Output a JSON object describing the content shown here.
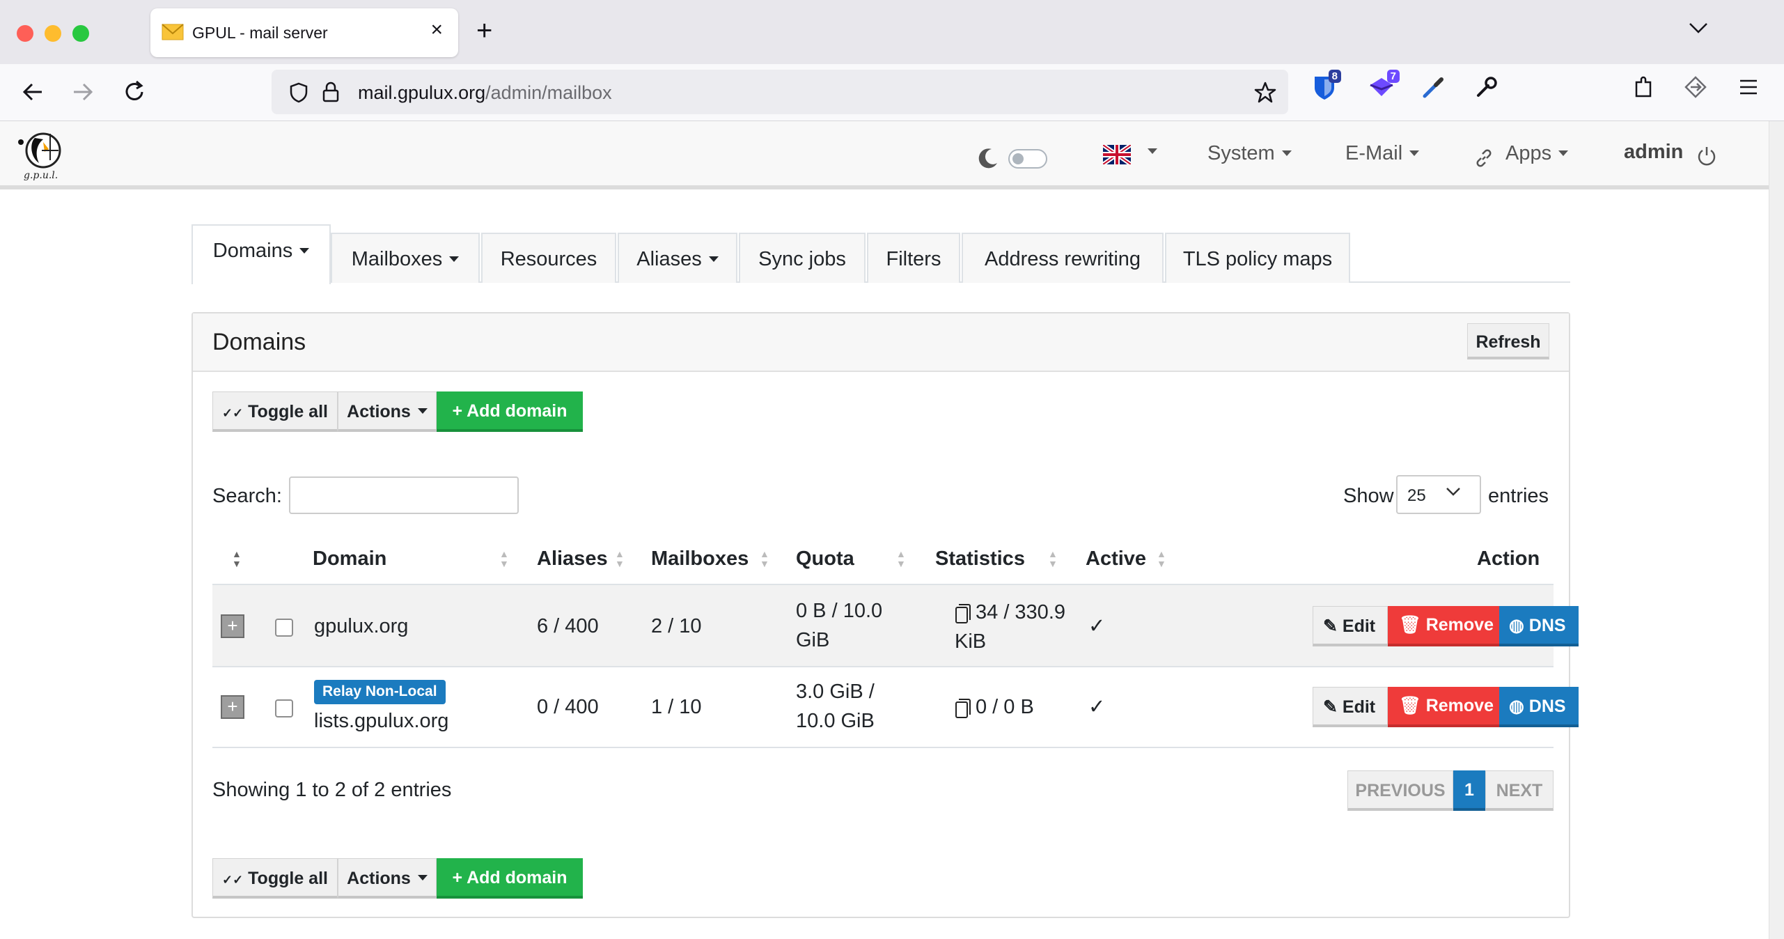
{
  "browser": {
    "tab_title": "GPUL - mail server",
    "url_host": "mail.gpulux.org",
    "url_path": "/admin/mailbox",
    "url_prefix": "",
    "ext_badges": [
      "8",
      "7"
    ]
  },
  "header": {
    "system": "System",
    "email": "E-Mail",
    "apps": "Apps",
    "user": "admin"
  },
  "tabs": [
    "Domains",
    "Mailboxes",
    "Resources",
    "Aliases",
    "Sync jobs",
    "Filters",
    "Address rewriting",
    "TLS policy maps"
  ],
  "panel": {
    "title": "Domains",
    "refresh": "Refresh",
    "toggle_all": "Toggle all",
    "actions": "Actions",
    "add_domain": "Add domain",
    "search_label": "Search:",
    "show_label": "Show",
    "show_value": "25",
    "entries_label": "entries"
  },
  "table": {
    "columns": [
      "Domain",
      "Aliases",
      "Mailboxes",
      "Quota",
      "Statistics",
      "Active",
      "Action"
    ],
    "rows": [
      {
        "badge": "",
        "domain": "gpulux.org",
        "aliases": "6 / 400",
        "mailboxes": "2 / 10",
        "quota_1": "0 B / 10.0",
        "quota_2": "GiB",
        "stats_1": "34 / 330.9",
        "stats_2": "KiB",
        "active": "✓"
      },
      {
        "badge": "Relay Non-Local",
        "domain": "lists.gpulux.org",
        "aliases": "0 / 400",
        "mailboxes": "1 / 10",
        "quota_1": "3.0 GiB /",
        "quota_2": "10.0 GiB",
        "stats_1": "0 / 0 B",
        "stats_2": "",
        "active": "✓"
      }
    ],
    "edit": "Edit",
    "remove": "Remove",
    "dns": "DNS"
  },
  "footer": {
    "showing": "Showing 1 to 2 of 2 entries",
    "previous": "PREVIOUS",
    "page": "1",
    "next": "NEXT"
  }
}
